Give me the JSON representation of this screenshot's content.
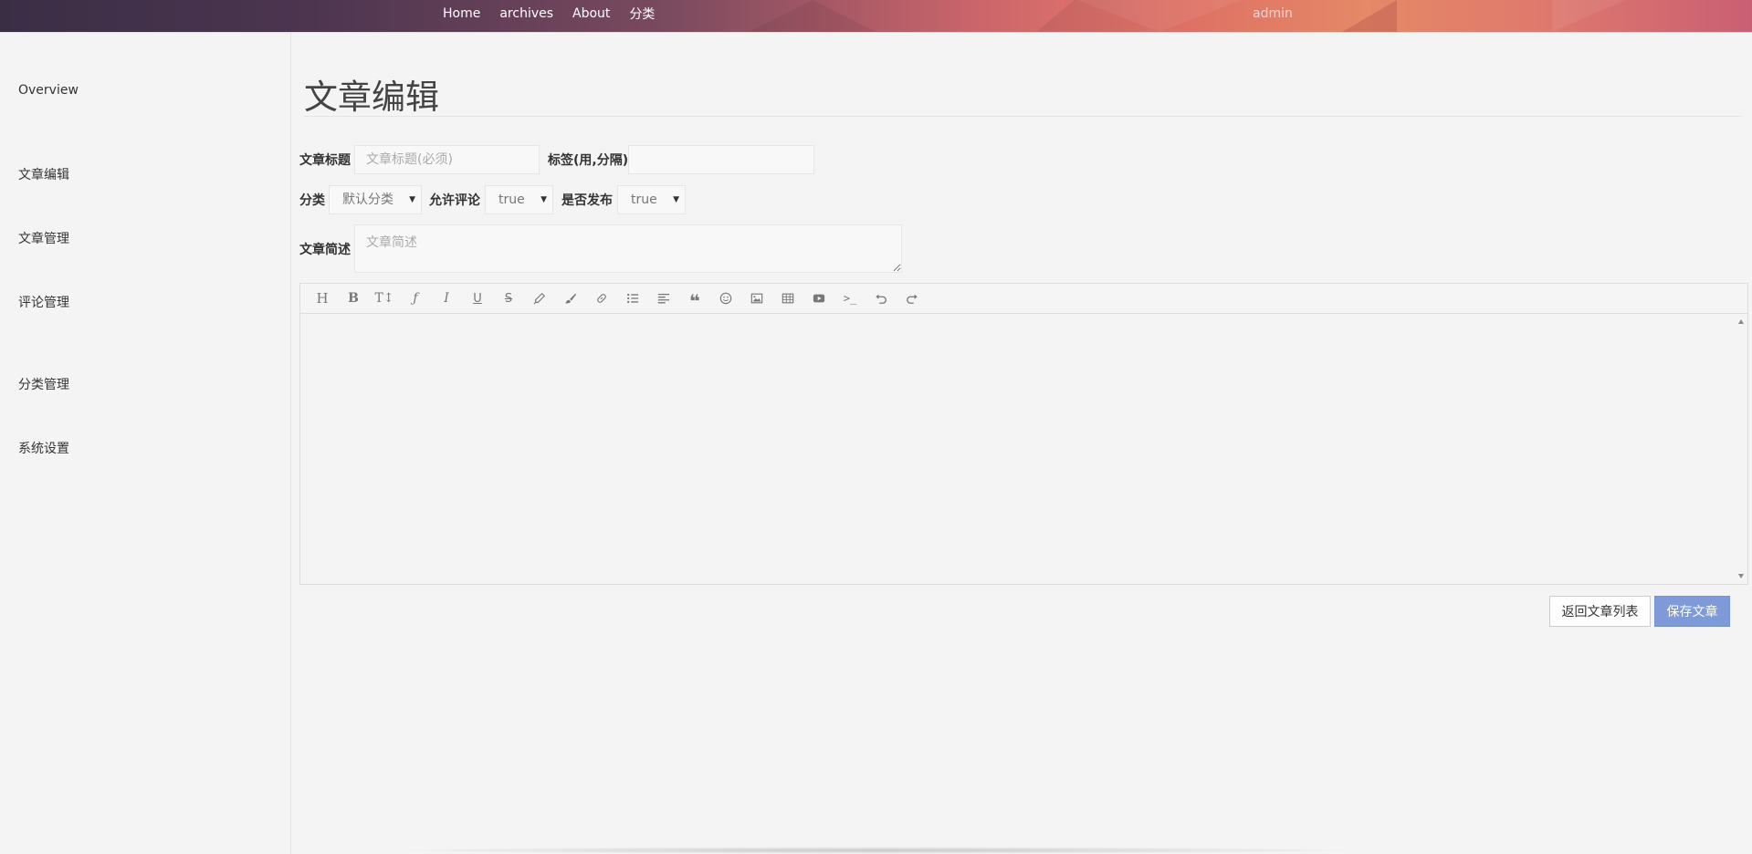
{
  "nav": {
    "links": [
      "Home",
      "archives",
      "About",
      "分类"
    ],
    "user": "admin"
  },
  "sidebar": {
    "items": [
      "Overview",
      "文章编辑",
      "文章管理",
      "评论管理",
      "分类管理",
      "系统设置"
    ]
  },
  "main": {
    "title": "文章编辑",
    "form": {
      "title_label": "文章标题",
      "title_placeholder": "文章标题(必须)",
      "title_value": "",
      "tags_label": "标签(用,分隔)",
      "tags_value": "",
      "category_label": "分类",
      "category_value": "默认分类",
      "allow_comment_label": "允许评论",
      "allow_comment_value": "true",
      "publish_label": "是否发布",
      "publish_value": "true",
      "summary_label": "文章简述",
      "summary_placeholder": "文章简述"
    },
    "editor": {
      "toolbar_icons": [
        "heading-icon",
        "bold-icon",
        "font-size-icon",
        "font-family-icon",
        "italic-icon",
        "underline-icon",
        "strikethrough-icon",
        "highlighter-icon",
        "brush-icon",
        "link-icon",
        "list-icon",
        "align-icon",
        "quote-icon",
        "emoji-icon",
        "image-icon",
        "table-icon",
        "video-icon",
        "code-icon",
        "undo-icon",
        "redo-icon"
      ]
    },
    "buttons": {
      "back": "返回文章列表",
      "save": "保存文章"
    }
  }
}
